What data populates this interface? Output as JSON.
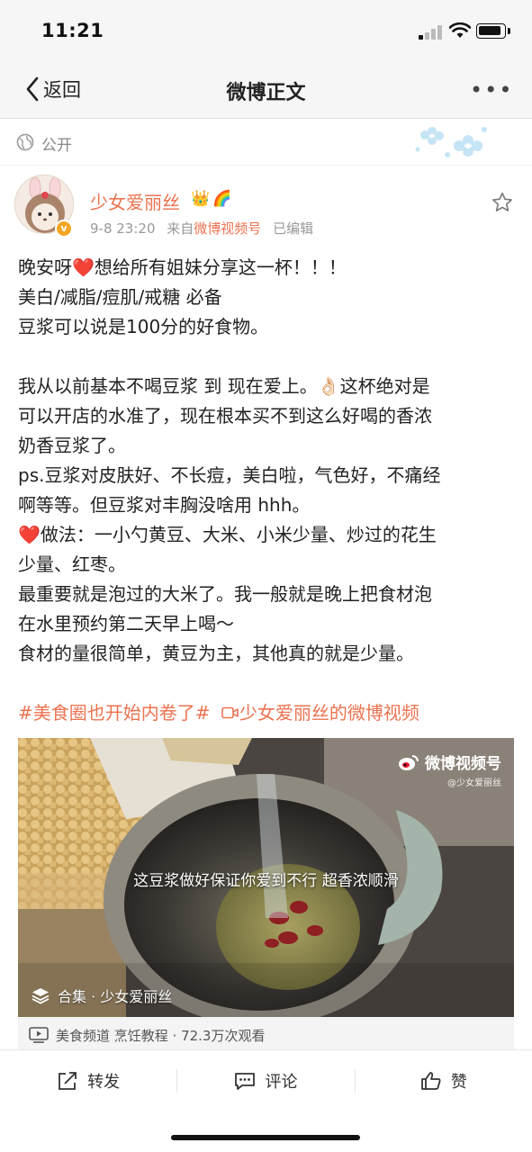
{
  "status_bar": {
    "time": "11:21",
    "battery_level": 0.85
  },
  "nav": {
    "back_label": "返回",
    "title": "微博正文",
    "more_icon": "more-dots-icon"
  },
  "visibility": {
    "label": "公开",
    "icon": "globe-icon"
  },
  "author": {
    "name": "少女爱丽丝",
    "badges": [
      "👑",
      "🌈"
    ],
    "verified_mark": "v",
    "time": "9-8 23:20",
    "source_prefix": "来自",
    "source": "微博视频号",
    "edited": "已编辑"
  },
  "post": {
    "lines": [
      {
        "before": "晚安呀",
        "heart": "❤️",
        "after": "想给所有姐妹分享这一杯！！！"
      },
      {
        "text": "美白/减脂/痘肌/戒糖 必备"
      },
      {
        "text": "豆浆可以说是100分的好食物。"
      },
      {
        "text": ""
      },
      {
        "text": "我从以前基本不喝豆浆 到 现在爱上。👌🏻这杯绝对是"
      },
      {
        "text": "可以开店的水准了，现在根本买不到这么好喝的香浓"
      },
      {
        "text": "奶香豆浆了。"
      },
      {
        "text": "ps.豆浆对皮肤好、不长痘，美白啦，气色好，不痛经"
      },
      {
        "text": "啊等等。但豆浆对丰胸没啥用 hhh。"
      },
      {
        "heart": "❤️",
        "after": "做法：一小勺黄豆、大米、小米少量、炒过的花生"
      },
      {
        "text": "少量、红枣。"
      },
      {
        "text": "最重要就是泡过的大米了。我一般就是晚上把食材泡"
      },
      {
        "text": "在水里预约第二天早上喝～"
      },
      {
        "text": "食材的量很简单，黄豆为主，其他真的就是少量。"
      },
      {
        "text": ""
      }
    ],
    "hashtag": "#美食圈也开始内卷了#",
    "video_link": "少女爱丽丝的微博视频"
  },
  "video": {
    "watermark_title": "微博视频号",
    "watermark_sub": "@少女爱丽丝",
    "caption": "这豆浆做好保证你爱到不行 超香浓顺滑",
    "collection": "合集 · 少女爱丽丝",
    "info": "美食频道 烹饪教程 · 72.3万次观看"
  },
  "actions": {
    "repost": "转发",
    "comment": "评论",
    "like": "赞"
  },
  "colors": {
    "accent": "#eb7350",
    "heart": "#e02a2a",
    "nav_bg": "#f6f6f6"
  }
}
